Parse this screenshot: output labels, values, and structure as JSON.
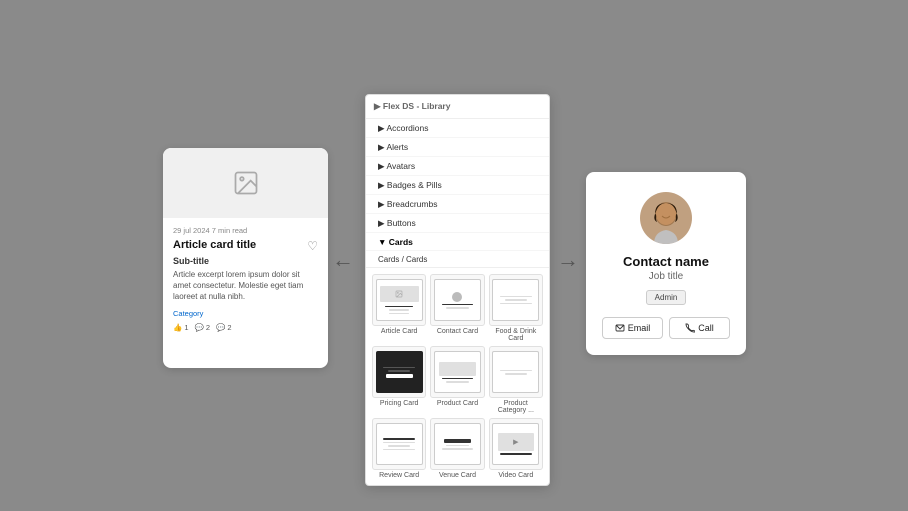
{
  "app": {
    "background": "#8a8a8a"
  },
  "library": {
    "header": "Flex DS - Library",
    "nav_items": [
      {
        "label": "Accordions",
        "active": false
      },
      {
        "label": "Alerts",
        "active": false
      },
      {
        "label": "Avatars",
        "active": false
      },
      {
        "label": "Badges & Pills",
        "active": false
      },
      {
        "label": "Breadcrumbs",
        "active": false
      },
      {
        "label": "Buttons",
        "active": false
      },
      {
        "label": "Cards",
        "active": true
      }
    ],
    "breadcrumb_parent": "Cards",
    "breadcrumb_child": "Cards",
    "cards": [
      {
        "label": "Article Card"
      },
      {
        "label": "Contact Card"
      },
      {
        "label": "Food & Drink Card"
      },
      {
        "label": "Pricing Card"
      },
      {
        "label": "Product Card"
      },
      {
        "label": "Product Category ..."
      },
      {
        "label": "Review Card"
      },
      {
        "label": "Venue Card"
      },
      {
        "label": "Video Card"
      }
    ]
  },
  "article_card": {
    "meta": "29 jul 2024  7 min read",
    "title": "Article card title",
    "subtitle": "Sub-title",
    "excerpt": "Article excerpt lorem ipsum dolor sit amet consectetur. Molestie eget tiam laoreet at nulla nibh.",
    "category": "Category",
    "likes": "1",
    "comments1": "2",
    "comments2": "2"
  },
  "contact_card": {
    "name": "Contact name",
    "job_title": "Job title",
    "badge": "Admin",
    "email_btn": "Email",
    "call_btn": "Call"
  },
  "arrows": {
    "left": "←",
    "right": "→"
  }
}
